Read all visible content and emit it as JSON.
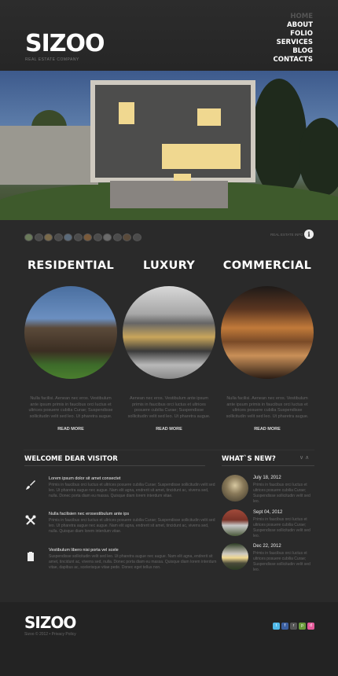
{
  "brand": {
    "logo": "SIZOO",
    "tagline": "REAL ESTATE COMPANY"
  },
  "nav": {
    "items": [
      "HOME",
      "ABOUT",
      "FOLIO",
      "SERVICES",
      "BLOG",
      "CONTACTS"
    ],
    "active": "HOME"
  },
  "slider": {
    "caption": "REAL ESTATE INFO",
    "info_icon": "info-icon"
  },
  "columns": [
    {
      "title": "RESIDENTIAL",
      "text": "Nulla facilisi. Aenean nec eros. Vestibulum ante ipsum primis in faucibus orci luctus et ultrices posuere cubilia Curae; Suspendisse sollicitudin velit sed leo. Ut pharetra augue.",
      "more": "READ MORE"
    },
    {
      "title": "LUXURY",
      "text": "Aenean nec eros. Vestibulum ante ipsum primis in faucibus orci luctus et ultrices posuere cubilia Curae; Suspendisse sollicitudin velit sed leo. Ut pharetra augue.",
      "more": "READ MORE"
    },
    {
      "title": "COMMERCIAL",
      "text": "Nulla facilisi. Aenean nec eros. Vestibulum ante ipsum primis in faucibus orci luctus et ultrices posuere cubilia Suspendisse sollicitudin velit sed leo. Ut pharetra augue.",
      "more": "READ MORE"
    }
  ],
  "welcome": {
    "title": "WELCOME DEAR VISITOR",
    "items": [
      {
        "icon": "brush-icon",
        "title": "Lorem ipsum dolor sit amet consectet",
        "text": "Primis in faucibus orci luctus et ultrices posuere cubilia Curae; Suspendisse sollicitudin velit sed leo. Ut pharetra augue nec augue. Nam elit agna, endrerit sit amet, tincidunt ac, viverra sed, nulla. Donec porta diam eu massa. Quisque diam lorem interdum vitae."
      },
      {
        "icon": "tools-icon",
        "title": "Nulla facilisien nec erosestibulum ante ips",
        "text": "Primis in faucibus orci luctus et ultrices posuere cubilia Curae; Suspendisse sollicitudin velit sed leo. Ut pharetra augue nec augue. Nam elit agna, endrerit sit amet, tincidunt ac, viverra sed, nulla. Quisque diam lorem interdum vitae."
      },
      {
        "icon": "clipboard-icon",
        "title": "Vestibulum libero nisi porta vel scele",
        "text": "Suspendisse sollicitudin velit sed leo. Ut pharetra augue nec augue. Nam elit agna, endrerit sit amet, tincidunt ac, viverra sed, nulla. Donec porta diam eu massa. Quisque diam lorem interdum vitae, dapibus ac, scelerisque vitae pede. Donec eget tellus non."
      }
    ]
  },
  "news": {
    "title": "WHAT`S NEW?",
    "items": [
      {
        "date": "July 18, 2012",
        "text": "Primis in faucibus orci luctus et ultrices posuere cubilia Curae; Suspendisse sollicitudin velit sed leo."
      },
      {
        "date": "Sept 04, 2012",
        "text": "Primis in faucibus orci luctus et ultrices posuere cubilia Curae; Suspendisse sollicitudin velit sed leo."
      },
      {
        "date": "Dec 22, 2012",
        "text": "Primis in faucibus orci luctus et ultrices posuere cubilia Curae; Suspendisse sollicitudin velit sed leo."
      }
    ]
  },
  "footer": {
    "logo": "SIZOO",
    "copyright": "Sizoo © 2012 • Privacy Policy",
    "social": [
      {
        "icon": "twitter-icon",
        "glyph": "t",
        "color": "#4fb8e8"
      },
      {
        "icon": "facebook-icon",
        "glyph": "f",
        "color": "#3b5fa0"
      },
      {
        "icon": "rss-icon",
        "glyph": "r",
        "color": "#555555"
      },
      {
        "icon": "picasa-icon",
        "glyph": "p",
        "color": "#6a9a3a"
      },
      {
        "icon": "dribbble-icon",
        "glyph": "d",
        "color": "#e45a9a"
      }
    ]
  }
}
